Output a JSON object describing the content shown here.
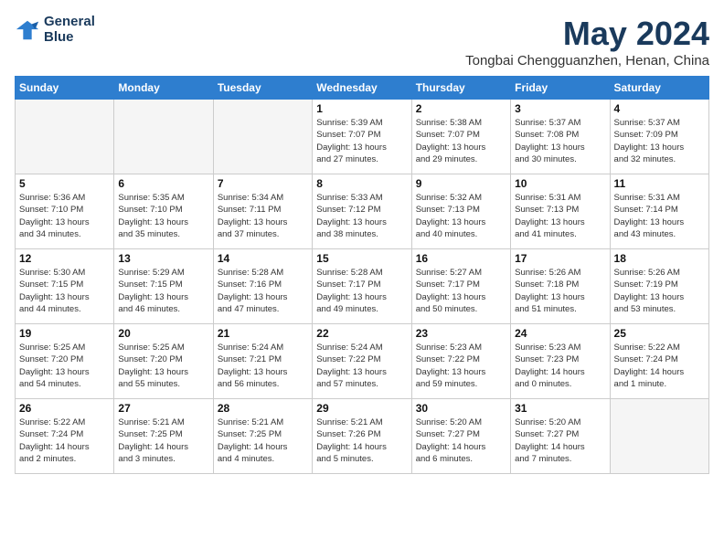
{
  "logo": {
    "line1": "General",
    "line2": "Blue"
  },
  "title": "May 2024",
  "location": "Tongbai Chengguanzhen, Henan, China",
  "headers": [
    "Sunday",
    "Monday",
    "Tuesday",
    "Wednesday",
    "Thursday",
    "Friday",
    "Saturday"
  ],
  "weeks": [
    [
      {
        "day": "",
        "info": ""
      },
      {
        "day": "",
        "info": ""
      },
      {
        "day": "",
        "info": ""
      },
      {
        "day": "1",
        "info": "Sunrise: 5:39 AM\nSunset: 7:07 PM\nDaylight: 13 hours\nand 27 minutes."
      },
      {
        "day": "2",
        "info": "Sunrise: 5:38 AM\nSunset: 7:07 PM\nDaylight: 13 hours\nand 29 minutes."
      },
      {
        "day": "3",
        "info": "Sunrise: 5:37 AM\nSunset: 7:08 PM\nDaylight: 13 hours\nand 30 minutes."
      },
      {
        "day": "4",
        "info": "Sunrise: 5:37 AM\nSunset: 7:09 PM\nDaylight: 13 hours\nand 32 minutes."
      }
    ],
    [
      {
        "day": "5",
        "info": "Sunrise: 5:36 AM\nSunset: 7:10 PM\nDaylight: 13 hours\nand 34 minutes."
      },
      {
        "day": "6",
        "info": "Sunrise: 5:35 AM\nSunset: 7:10 PM\nDaylight: 13 hours\nand 35 minutes."
      },
      {
        "day": "7",
        "info": "Sunrise: 5:34 AM\nSunset: 7:11 PM\nDaylight: 13 hours\nand 37 minutes."
      },
      {
        "day": "8",
        "info": "Sunrise: 5:33 AM\nSunset: 7:12 PM\nDaylight: 13 hours\nand 38 minutes."
      },
      {
        "day": "9",
        "info": "Sunrise: 5:32 AM\nSunset: 7:13 PM\nDaylight: 13 hours\nand 40 minutes."
      },
      {
        "day": "10",
        "info": "Sunrise: 5:31 AM\nSunset: 7:13 PM\nDaylight: 13 hours\nand 41 minutes."
      },
      {
        "day": "11",
        "info": "Sunrise: 5:31 AM\nSunset: 7:14 PM\nDaylight: 13 hours\nand 43 minutes."
      }
    ],
    [
      {
        "day": "12",
        "info": "Sunrise: 5:30 AM\nSunset: 7:15 PM\nDaylight: 13 hours\nand 44 minutes."
      },
      {
        "day": "13",
        "info": "Sunrise: 5:29 AM\nSunset: 7:15 PM\nDaylight: 13 hours\nand 46 minutes."
      },
      {
        "day": "14",
        "info": "Sunrise: 5:28 AM\nSunset: 7:16 PM\nDaylight: 13 hours\nand 47 minutes."
      },
      {
        "day": "15",
        "info": "Sunrise: 5:28 AM\nSunset: 7:17 PM\nDaylight: 13 hours\nand 49 minutes."
      },
      {
        "day": "16",
        "info": "Sunrise: 5:27 AM\nSunset: 7:17 PM\nDaylight: 13 hours\nand 50 minutes."
      },
      {
        "day": "17",
        "info": "Sunrise: 5:26 AM\nSunset: 7:18 PM\nDaylight: 13 hours\nand 51 minutes."
      },
      {
        "day": "18",
        "info": "Sunrise: 5:26 AM\nSunset: 7:19 PM\nDaylight: 13 hours\nand 53 minutes."
      }
    ],
    [
      {
        "day": "19",
        "info": "Sunrise: 5:25 AM\nSunset: 7:20 PM\nDaylight: 13 hours\nand 54 minutes."
      },
      {
        "day": "20",
        "info": "Sunrise: 5:25 AM\nSunset: 7:20 PM\nDaylight: 13 hours\nand 55 minutes."
      },
      {
        "day": "21",
        "info": "Sunrise: 5:24 AM\nSunset: 7:21 PM\nDaylight: 13 hours\nand 56 minutes."
      },
      {
        "day": "22",
        "info": "Sunrise: 5:24 AM\nSunset: 7:22 PM\nDaylight: 13 hours\nand 57 minutes."
      },
      {
        "day": "23",
        "info": "Sunrise: 5:23 AM\nSunset: 7:22 PM\nDaylight: 13 hours\nand 59 minutes."
      },
      {
        "day": "24",
        "info": "Sunrise: 5:23 AM\nSunset: 7:23 PM\nDaylight: 14 hours\nand 0 minutes."
      },
      {
        "day": "25",
        "info": "Sunrise: 5:22 AM\nSunset: 7:24 PM\nDaylight: 14 hours\nand 1 minute."
      }
    ],
    [
      {
        "day": "26",
        "info": "Sunrise: 5:22 AM\nSunset: 7:24 PM\nDaylight: 14 hours\nand 2 minutes."
      },
      {
        "day": "27",
        "info": "Sunrise: 5:21 AM\nSunset: 7:25 PM\nDaylight: 14 hours\nand 3 minutes."
      },
      {
        "day": "28",
        "info": "Sunrise: 5:21 AM\nSunset: 7:25 PM\nDaylight: 14 hours\nand 4 minutes."
      },
      {
        "day": "29",
        "info": "Sunrise: 5:21 AM\nSunset: 7:26 PM\nDaylight: 14 hours\nand 5 minutes."
      },
      {
        "day": "30",
        "info": "Sunrise: 5:20 AM\nSunset: 7:27 PM\nDaylight: 14 hours\nand 6 minutes."
      },
      {
        "day": "31",
        "info": "Sunrise: 5:20 AM\nSunset: 7:27 PM\nDaylight: 14 hours\nand 7 minutes."
      },
      {
        "day": "",
        "info": ""
      }
    ]
  ]
}
